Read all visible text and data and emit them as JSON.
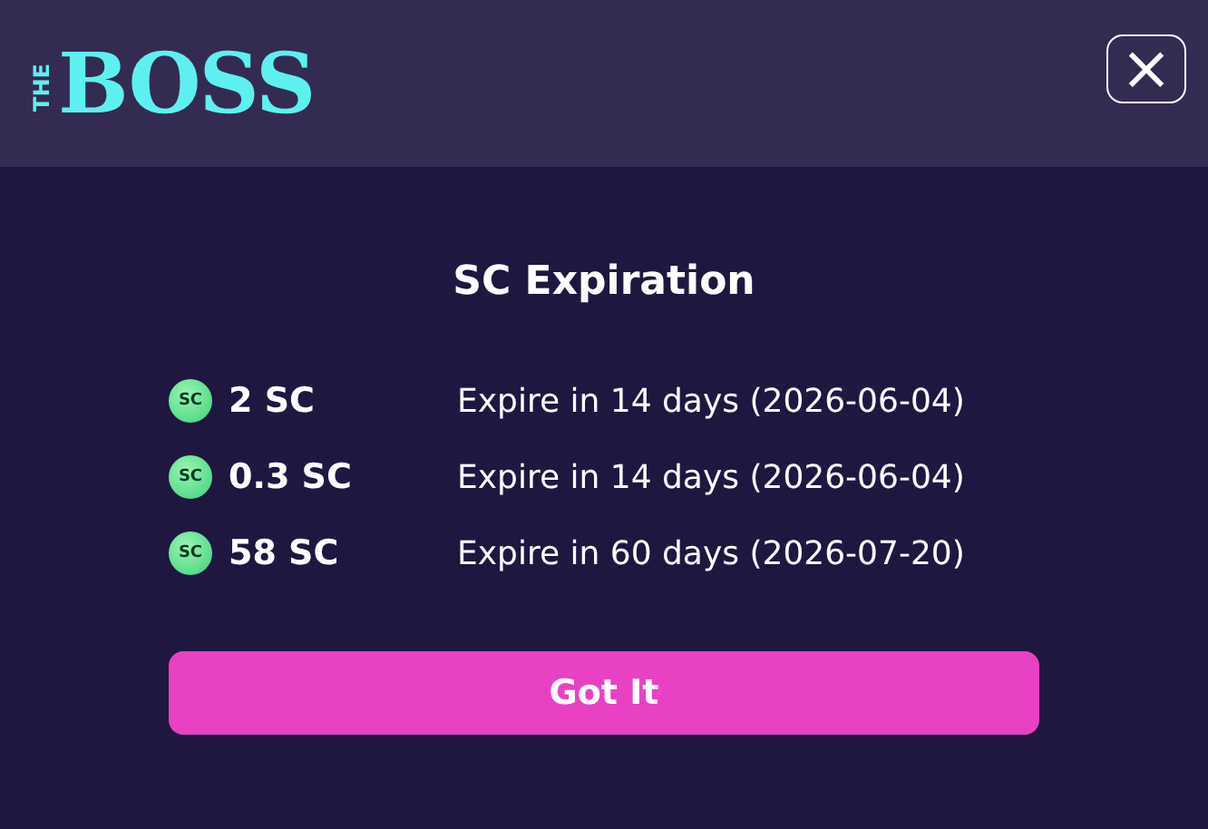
{
  "logo": {
    "small": "THE",
    "big": "BOSS"
  },
  "close_button": {
    "label": "×"
  },
  "dialog": {
    "title": "SC Expiration",
    "rows": [
      {
        "coin": "SC",
        "amount": "2 SC",
        "expiry": "Expire in 14 days (2026-06-04)"
      },
      {
        "coin": "SC",
        "amount": "0.3 SC",
        "expiry": "Expire in 14 days (2026-06-04)"
      },
      {
        "coin": "SC",
        "amount": "58 SC",
        "expiry": "Expire in 60 days (2026-07-20)"
      }
    ],
    "button": "Got It"
  }
}
